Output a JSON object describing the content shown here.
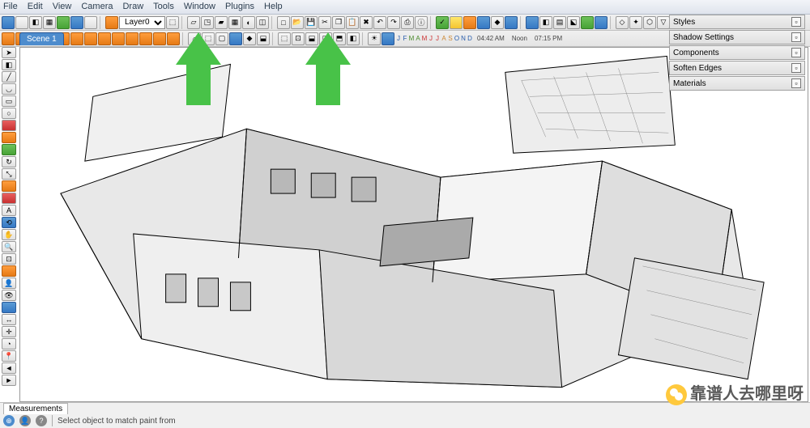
{
  "menu": {
    "items": [
      "File",
      "Edit",
      "View",
      "Camera",
      "Draw",
      "Tools",
      "Window",
      "Plugins",
      "Help"
    ]
  },
  "layer": {
    "selected": "Layer0"
  },
  "months": [
    "J",
    "F",
    "M",
    "A",
    "M",
    "J",
    "J",
    "A",
    "S",
    "O",
    "N",
    "D"
  ],
  "time": {
    "left": "04:42 AM",
    "mid": "Noon",
    "right": "07:15 PM"
  },
  "scene_tab": "Scene 1",
  "panels": [
    "Styles",
    "Shadow Settings",
    "Components",
    "Soften Edges",
    "Materials"
  ],
  "statusbar": {
    "tab": "Measurements",
    "hint": "Select object to match paint from"
  },
  "watermark": "靠谱人去哪里呀"
}
